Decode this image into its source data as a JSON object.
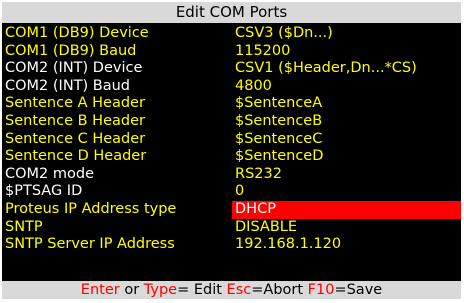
{
  "title": "Edit COM Ports",
  "colors": {
    "background": "#000000",
    "bar": "#d9d9d9",
    "yellow": "#ffff00",
    "white": "#ffffff",
    "highlight": "#ff0000"
  },
  "rows": [
    {
      "label": "COM1 (DB9) Device",
      "value": "CSV3 ($Dn...)",
      "label_color": "#ffff00",
      "value_color": "#ffff00"
    },
    {
      "label": "COM1 (DB9) Baud",
      "value": "115200",
      "label_color": "#ffff00",
      "value_color": "#ffff00"
    },
    {
      "label": "COM2 (INT) Device",
      "value": "CSV1 ($Header,Dn...*CS)",
      "label_color": "#ffffff",
      "value_color": "#ffff00"
    },
    {
      "label": "COM2 (INT) Baud",
      "value": "4800",
      "label_color": "#ffffff",
      "value_color": "#ffff00"
    },
    {
      "label": "Sentence A Header",
      "value": "$SentenceA",
      "label_color": "#ffff00",
      "value_color": "#ffff00"
    },
    {
      "label": "Sentence B Header",
      "value": "$SentenceB",
      "label_color": "#ffff00",
      "value_color": "#ffff00"
    },
    {
      "label": "Sentence C Header",
      "value": "$SentenceC",
      "label_color": "#ffff00",
      "value_color": "#ffff00"
    },
    {
      "label": "Sentence D Header",
      "value": "$SentenceD",
      "label_color": "#ffff00",
      "value_color": "#ffff00"
    },
    {
      "label": "COM2 mode",
      "value": "RS232",
      "label_color": "#ffffff",
      "value_color": "#ffff00"
    },
    {
      "label": "$PTSAG ID",
      "value": "0",
      "label_color": "#ffffff",
      "value_color": "#ffff00"
    },
    {
      "label": "Proteus IP Address type",
      "value": "DHCP",
      "label_color": "#ffff00",
      "value_color": "#ffffff",
      "selected": true
    },
    {
      "label": "SNTP",
      "value": "DISABLE",
      "label_color": "#ffff00",
      "value_color": "#ffff00"
    },
    {
      "label": "SNTP Server IP Address",
      "value": "192.168.1.120",
      "label_color": "#ffff00",
      "value_color": "#ffff00"
    }
  ],
  "footer": {
    "key_enter": "Enter",
    "or": " or ",
    "key_type": "Type",
    "edit": "= Edit ",
    "key_esc": "Esc",
    "abort": "=Abort ",
    "key_f10": "F10",
    "save": "=Save"
  }
}
